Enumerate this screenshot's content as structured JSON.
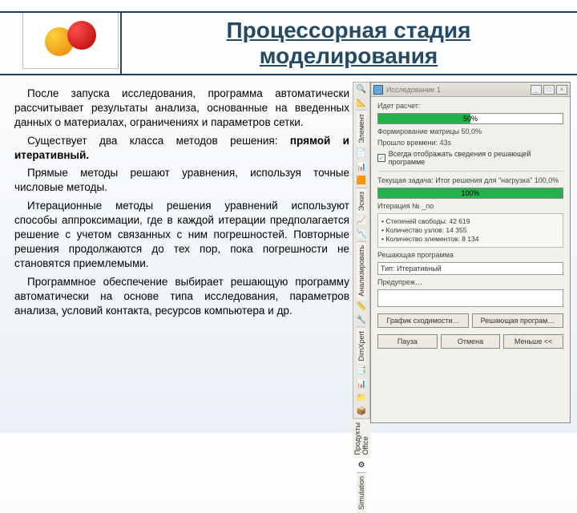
{
  "header": {
    "title_line1": "Процессорная стадия",
    "title_line2": "моделирования"
  },
  "body": {
    "p1": "После запуска исследования, программа автоматически рассчитывает результаты анализа, основанные на введенных данных о материалах, ограничениях и параметров сетки.",
    "p2a": "Существует два класса методов решения:",
    "p2b": "прямой и итеративный.",
    "p3": "Прямые методы решают уравнения, используя точные числовые методы.",
    "p4": "Итерационные методы решения уравнений используют способы аппроксимации, где в каждой итерации предполагается решение с учетом связанных с ним погрешностей. Повторные решения продолжаются до тех пор, пока погрешности не становятся приемлемыми.",
    "p5": "Программное обеспечение выбирает решающую программу автоматически на основе типа исследования, параметров анализа, условий контакта, ресурсов компьютера и др."
  },
  "vtool1": {
    "label": "Элемент",
    "icons": [
      "🔍",
      "📐"
    ]
  },
  "vtool2": {
    "label": "Эскиз",
    "icons": [
      "📄",
      "📊",
      "🟧"
    ]
  },
  "vtool3": {
    "label": "Анализировать",
    "icons": [
      "📈",
      "📉"
    ]
  },
  "vtool4": {
    "label": "DimXpert",
    "icons": [
      "📏",
      "🔧"
    ]
  },
  "vtool5": {
    "label": "Продукты Office",
    "icons": [
      "📑",
      "📊",
      "📁",
      "📦"
    ]
  },
  "vtool6": {
    "label": "Simulation",
    "icons": [
      "⚙"
    ]
  },
  "dialog": {
    "title": "Исследование 1",
    "solving_label": "Идет расчет:",
    "progress1_pct": 50,
    "progress1_text": "50%",
    "match_label": "Формирование матрицы 50,0%",
    "elapsed_label": "Прошло времени: 43s",
    "always_show_label": " Всегда отображать сведения о решающей программе",
    "task_label": "Текущая задача: Итог решения для \"нагрузка\" 100,0%",
    "progress2_pct": 100,
    "progress2_text": "100%",
    "iter_label": "Итерация № _no",
    "info_line1": "• Степеней свободы: 42 619",
    "info_line2": "• Количество узлов: 14 355",
    "info_line3": "• Количество элементов: 8 134",
    "solver_heading": "Решающая программа",
    "solver_type_label": "Тип: Итеративный",
    "warning_label": "Предупреж…",
    "btn_graph": "График сходимости…",
    "btn_solver": "Решающая програм…",
    "btn_pause": "Пауза",
    "btn_cancel": "Отмена",
    "btn_more": "Меньше <<"
  }
}
